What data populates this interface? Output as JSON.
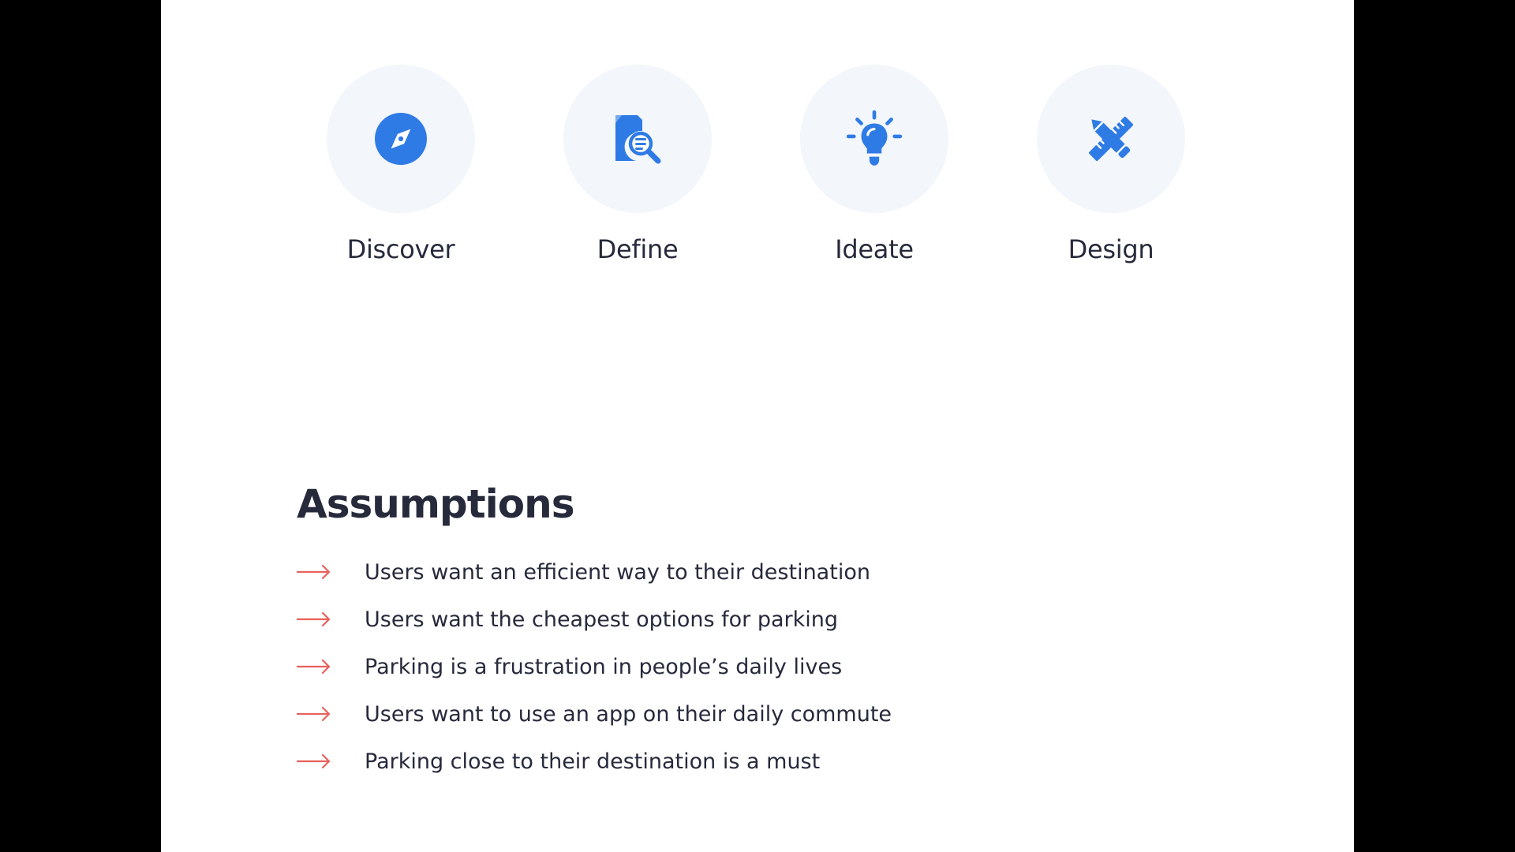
{
  "steps": [
    {
      "label": "Discover",
      "icon": "compass-icon"
    },
    {
      "label": "Define",
      "icon": "document-search-icon"
    },
    {
      "label": "Ideate",
      "icon": "lightbulb-icon"
    },
    {
      "label": "Design",
      "icon": "pencil-ruler-icon"
    }
  ],
  "assumptions": {
    "title": "Assumptions",
    "items": [
      "Users want an efficient way to their destination",
      "Users want the cheapest options for parking",
      "Parking is a frustration in people’s daily lives",
      "Users want to use an app on their daily commute",
      "Parking close to their destination is a must"
    ]
  },
  "colors": {
    "page_background": "#ffffff",
    "outer_background": "#000000",
    "icon_blue": "#2f7be5",
    "icon_circle": "#f3f6fb",
    "text": "#262a3b",
    "arrow": "#e8615c"
  }
}
